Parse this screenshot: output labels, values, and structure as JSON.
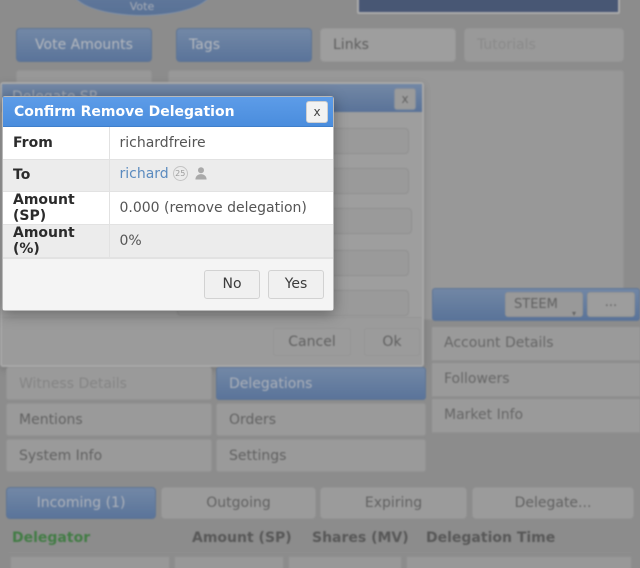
{
  "background": {
    "top_oval_label": "Vote",
    "tabs": [
      {
        "label": "Vote Amounts",
        "state": "active"
      },
      {
        "label": "Tags",
        "state": "active"
      },
      {
        "label": "Links",
        "state": "light"
      },
      {
        "label": "Tutorials",
        "state": "muted"
      }
    ],
    "delegate_dialog": {
      "title": "Delegate SP",
      "close_label": "x",
      "cancel_label": "Cancel",
      "ok_label": "Ok"
    },
    "steem_bar": {
      "selected": "STEEM",
      "caret": "▾",
      "more_label": "..."
    },
    "side_items": [
      {
        "label": "Account Details"
      },
      {
        "label": "Followers"
      },
      {
        "label": "Market Info"
      }
    ],
    "nav_buttons": [
      {
        "label": "Witness Details",
        "state": "dim"
      },
      {
        "label": "Delegations",
        "state": "sel"
      },
      {
        "label": "Mentions",
        "state": "normal"
      },
      {
        "label": "Orders",
        "state": "normal"
      },
      {
        "label": "System Info",
        "state": "normal"
      },
      {
        "label": "Settings",
        "state": "normal"
      }
    ],
    "sub_tabs": [
      {
        "label": "Incoming (1)",
        "state": "sel"
      },
      {
        "label": "Outgoing",
        "state": "normal"
      },
      {
        "label": "Expiring",
        "state": "normal"
      },
      {
        "label": "Delegate...",
        "state": "normal"
      }
    ],
    "table_headers": [
      {
        "label": "Delegator",
        "accent": "#17801c"
      },
      {
        "label": "Amount (SP)",
        "accent": "#3e3e3e"
      },
      {
        "label": "Shares (MV)",
        "accent": "#3e3e3e"
      },
      {
        "label": "Delegation Time",
        "accent": "#3e3e3e"
      }
    ]
  },
  "modal": {
    "title": "Confirm Remove Delegation",
    "close_label": "x",
    "rows": [
      {
        "key": "From",
        "value": "richardfreire",
        "type": "text"
      },
      {
        "key": "To",
        "value": "richard",
        "badge": "25",
        "type": "account"
      },
      {
        "key": "Amount (SP)",
        "value": "0.000 (remove delegation)",
        "type": "text"
      },
      {
        "key": "Amount (%)",
        "value": "0%",
        "type": "text"
      }
    ],
    "buttons": {
      "no": "No",
      "yes": "Yes"
    }
  },
  "colors": {
    "modal_title_blue": "#4a8ddd",
    "accent_blue": "#4271b6",
    "link_blue": "#5b8bbf",
    "delegator_green": "#17801c",
    "page_grey": "#9d9d9d"
  }
}
